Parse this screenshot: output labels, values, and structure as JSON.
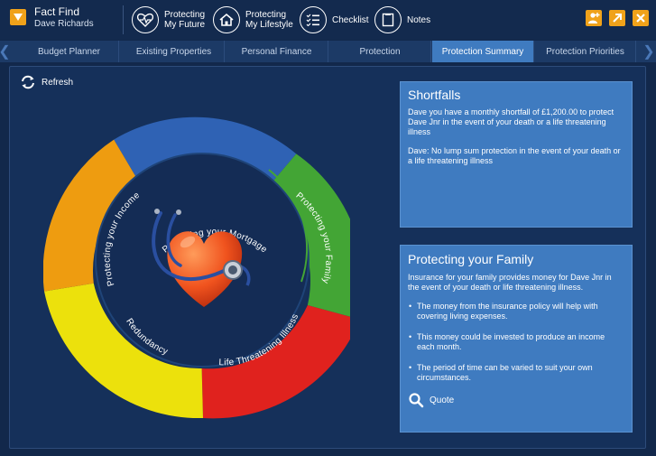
{
  "header": {
    "title": "Fact Find",
    "user": "Dave Richards",
    "nav": [
      {
        "line1": "Protecting",
        "line2": "My Future",
        "icon": "heartbeat-icon"
      },
      {
        "line1": "Protecting",
        "line2": "My Lifestyle",
        "icon": "house-icon"
      },
      {
        "line1": "Checklist",
        "line2": "",
        "icon": "checklist-icon"
      },
      {
        "line1": "Notes",
        "line2": "",
        "icon": "notes-icon"
      }
    ]
  },
  "tabs": [
    {
      "label": "Budget Planner"
    },
    {
      "label": "Existing Properties"
    },
    {
      "label": "Personal Finance"
    },
    {
      "label": "Protection"
    },
    {
      "label": "Protection Summary"
    },
    {
      "label": "Protection Priorities"
    }
  ],
  "active_tab": "Protection Summary",
  "refresh_label": "Refresh",
  "wheel": {
    "segments": [
      {
        "label": "Protecting your Mortgage",
        "color": "#2f62b4"
      },
      {
        "label": "Protecting your Family",
        "color": "#43a535"
      },
      {
        "label": "Life Threatening Illness",
        "color": "#e0221e"
      },
      {
        "label": "Redundancy",
        "color": "#ece10c"
      },
      {
        "label": "Protecting your Income",
        "color": "#ee9c10"
      }
    ]
  },
  "shortfalls": {
    "title": "Shortfalls",
    "p1": "Dave you have a monthly shortfall of £1,200.00 to protect Dave Jnr in the event of your death or a life threatening illness",
    "p2": "Dave: No lump sum protection in the event of your death or a life threatening illness"
  },
  "family": {
    "title": "Protecting your Family",
    "intro": "Insurance for your family provides money for Dave Jnr in the event of your death or life threatening illness.",
    "bullets": [
      "The money from the insurance policy will help with covering living expenses.",
      "This money could be invested to produce an income each month.",
      "The period of time can be varied to suit your own circumstances."
    ],
    "quote_label": "Quote"
  },
  "colors": {
    "accent": "#f0a21a",
    "panel": "#3f7bc0",
    "background": "#12284b"
  }
}
